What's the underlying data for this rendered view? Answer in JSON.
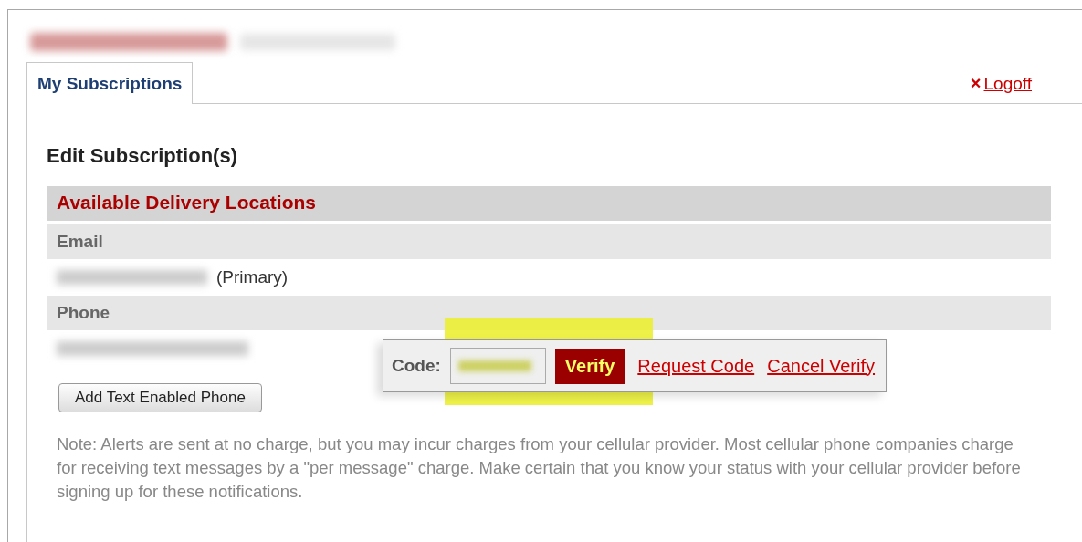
{
  "tabs": [
    {
      "label": "My Subscriptions",
      "selected": true
    }
  ],
  "logoff": {
    "icon": "×",
    "label": "Logoff"
  },
  "heading": "Edit Subscription(s)",
  "table": {
    "title": "Available Delivery Locations",
    "sections": [
      {
        "label": "Email",
        "suffix": "(Primary)"
      },
      {
        "label": "Phone"
      }
    ]
  },
  "verify_popup": {
    "label": "Code:",
    "button": "Verify",
    "links": [
      "Request Code",
      "Cancel Verify"
    ],
    "highlighted": true
  },
  "add_button": "Add Text Enabled Phone",
  "note": "Note: Alerts are sent at no charge, but you may incur charges from your cellular provider. Most cellular phone companies charge for receiving text messages by a \"per message\" charge. Make certain that you know your status with your cellular provider before signing up for these notifications."
}
